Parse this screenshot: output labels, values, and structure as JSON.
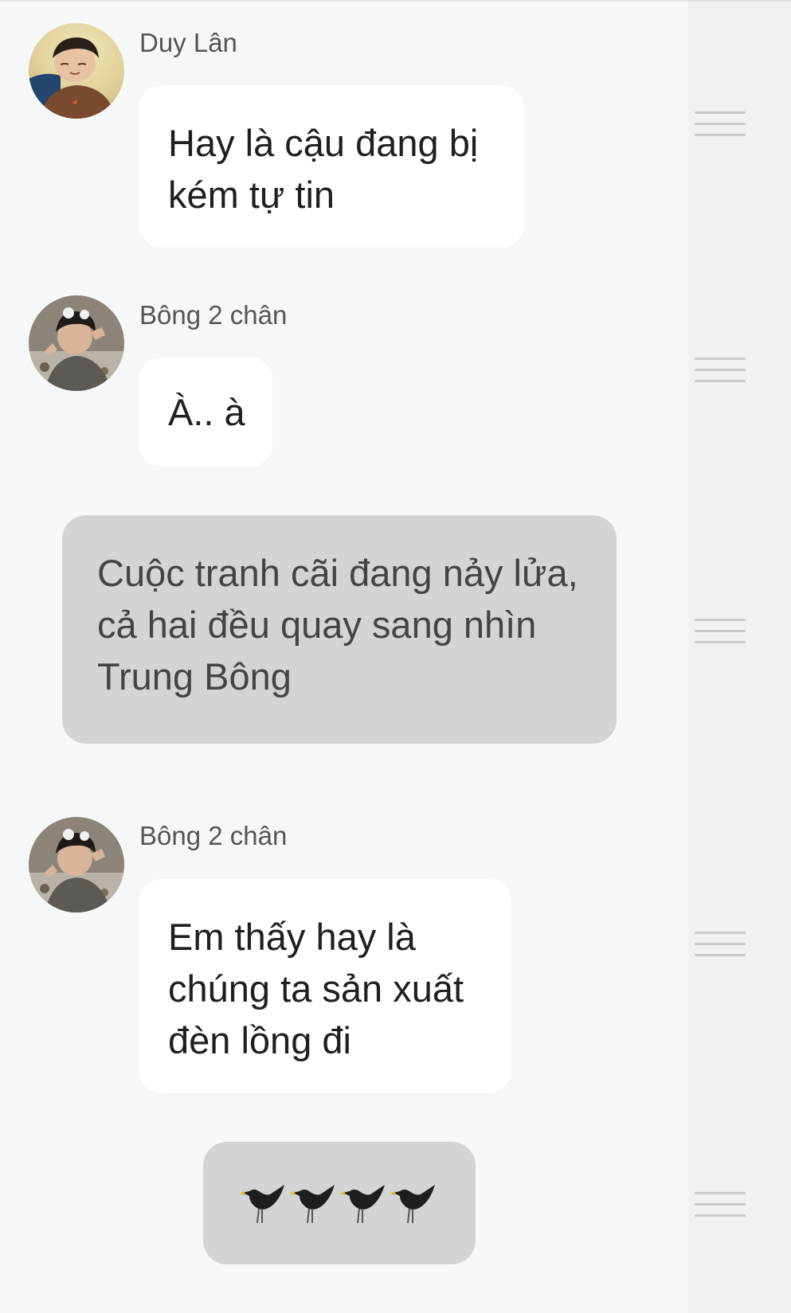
{
  "messages": [
    {
      "type": "incoming",
      "sender": "Duy Lân",
      "avatar": "avatar-duy-lan",
      "lines": [
        "Hay là cậu đang bị",
        "kém tự tin"
      ]
    },
    {
      "type": "incoming",
      "sender": "Bông 2 chân",
      "avatar": "avatar-bong-2-chan",
      "lines": [
        "À.. à"
      ]
    },
    {
      "type": "narration",
      "lines": [
        "Cuộc tranh cãi đang nảy lửa,",
        "cả hai đều quay sang nhìn",
        "Trung Bông"
      ]
    },
    {
      "type": "incoming",
      "sender": "Bông 2 chân",
      "avatar": "avatar-bong-2-chan",
      "lines": [
        "Em thấy hay là",
        "chúng ta sản xuất",
        "đèn lồng đi"
      ]
    },
    {
      "type": "narration",
      "emoji": "crow-emoji",
      "emoji_count": 4
    }
  ],
  "colors": {
    "background": "#f6f7f9",
    "side_rail": "#f1f1f2",
    "bubble": "#ffffff",
    "narration_bubble": "#d3d4d6",
    "handle": "#c8c9cc",
    "sender_text": "#555555"
  },
  "icons": {
    "drag_handle": "drag-handle-icon",
    "bird": "black-bird-icon"
  }
}
